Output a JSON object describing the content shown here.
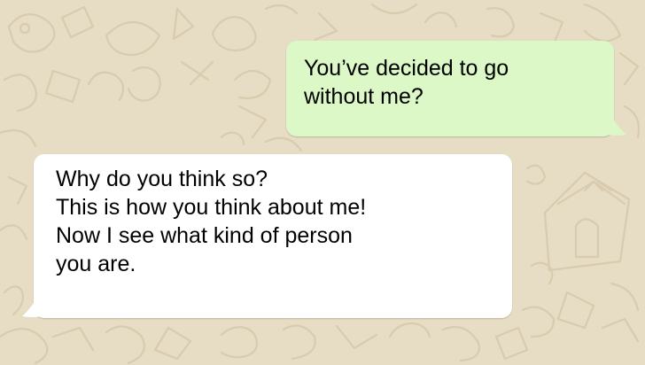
{
  "colors": {
    "wallpaper": "#e7dcc4",
    "outgoing_bubble": "#dcf8c6",
    "incoming_bubble": "#ffffff",
    "doodle_stroke": "#d8cbae"
  },
  "messages": [
    {
      "direction": "outgoing",
      "lines": [
        "You’ve decided to go",
        "without me?"
      ]
    },
    {
      "direction": "incoming",
      "lines": [
        "Why do you think so?",
        "This is how you think about me!",
        "Now I see what kind of person",
        "you are."
      ]
    }
  ]
}
